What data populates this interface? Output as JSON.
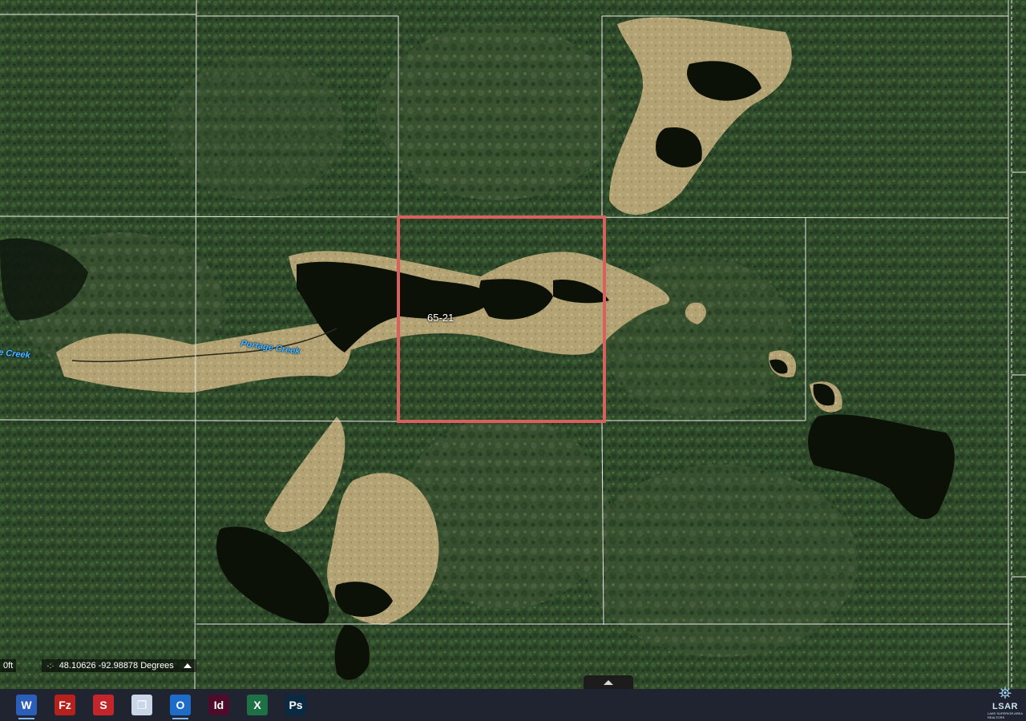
{
  "map": {
    "parcel_label": "65-21",
    "creek_label_main": "Portage Creek",
    "creek_label_edge": "e Creek",
    "colors": {
      "parcel_outline": "#d9605f",
      "section_lines": "#e8e8e8",
      "water": "#0c1108",
      "marsh": "#b8a678",
      "forest": "#2f4a2a"
    }
  },
  "status": {
    "scale_text": "0ft",
    "coordinates": "48.10626 -92.98878 Degrees"
  },
  "taskbar": {
    "apps": [
      {
        "name": "word",
        "glyph": "W",
        "color": "#2b5eb8"
      },
      {
        "name": "filezilla",
        "glyph": "Fz",
        "color": "#b5221d"
      },
      {
        "name": "app-s",
        "glyph": "S",
        "color": "#c2262b"
      },
      {
        "name": "file-explorer",
        "glyph": "❐",
        "color": "#c9d6e8"
      },
      {
        "name": "outlook",
        "glyph": "O",
        "color": "#1c6cc8"
      },
      {
        "name": "indesign",
        "glyph": "Id",
        "color": "#4d0c2a"
      },
      {
        "name": "excel",
        "glyph": "X",
        "color": "#1e7145"
      },
      {
        "name": "photoshop",
        "glyph": "Ps",
        "color": "#0a2a44"
      }
    ]
  },
  "logo": {
    "text": "LSAR",
    "sub": "LAKE SUPERIOR AREA REALTORS"
  }
}
